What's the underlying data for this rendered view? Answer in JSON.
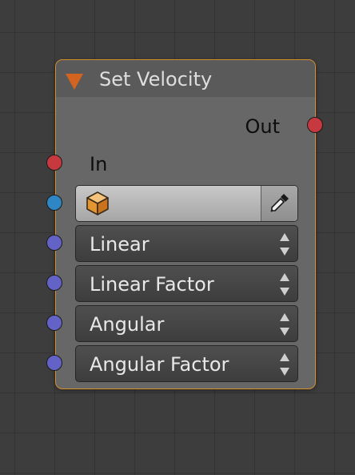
{
  "node": {
    "title": "Set Velocity",
    "collapse_icon": "triangle-down-icon",
    "header_icon_color": "#d3641f",
    "border_color": "#d88f2a",
    "outputs": [
      {
        "label": "Out",
        "socket_color": "#c8393f"
      }
    ],
    "inputs": [
      {
        "label": "In",
        "socket_color": "#c8393f",
        "type": "text"
      },
      {
        "label": "",
        "socket_color": "#2f86c4",
        "type": "object-field",
        "icon": "cube-icon",
        "button_icon": "eyedropper-icon"
      },
      {
        "label": "Linear",
        "socket_color": "#6363c7",
        "type": "dropdown",
        "icon": "updown-arrows-icon"
      },
      {
        "label": "Linear Factor",
        "socket_color": "#6363c7",
        "type": "dropdown",
        "icon": "updown-arrows-icon"
      },
      {
        "label": "Angular",
        "socket_color": "#6363c7",
        "type": "dropdown",
        "icon": "updown-arrows-icon"
      },
      {
        "label": "Angular Factor",
        "socket_color": "#6363c7",
        "type": "dropdown",
        "icon": "updown-arrows-icon"
      }
    ]
  }
}
